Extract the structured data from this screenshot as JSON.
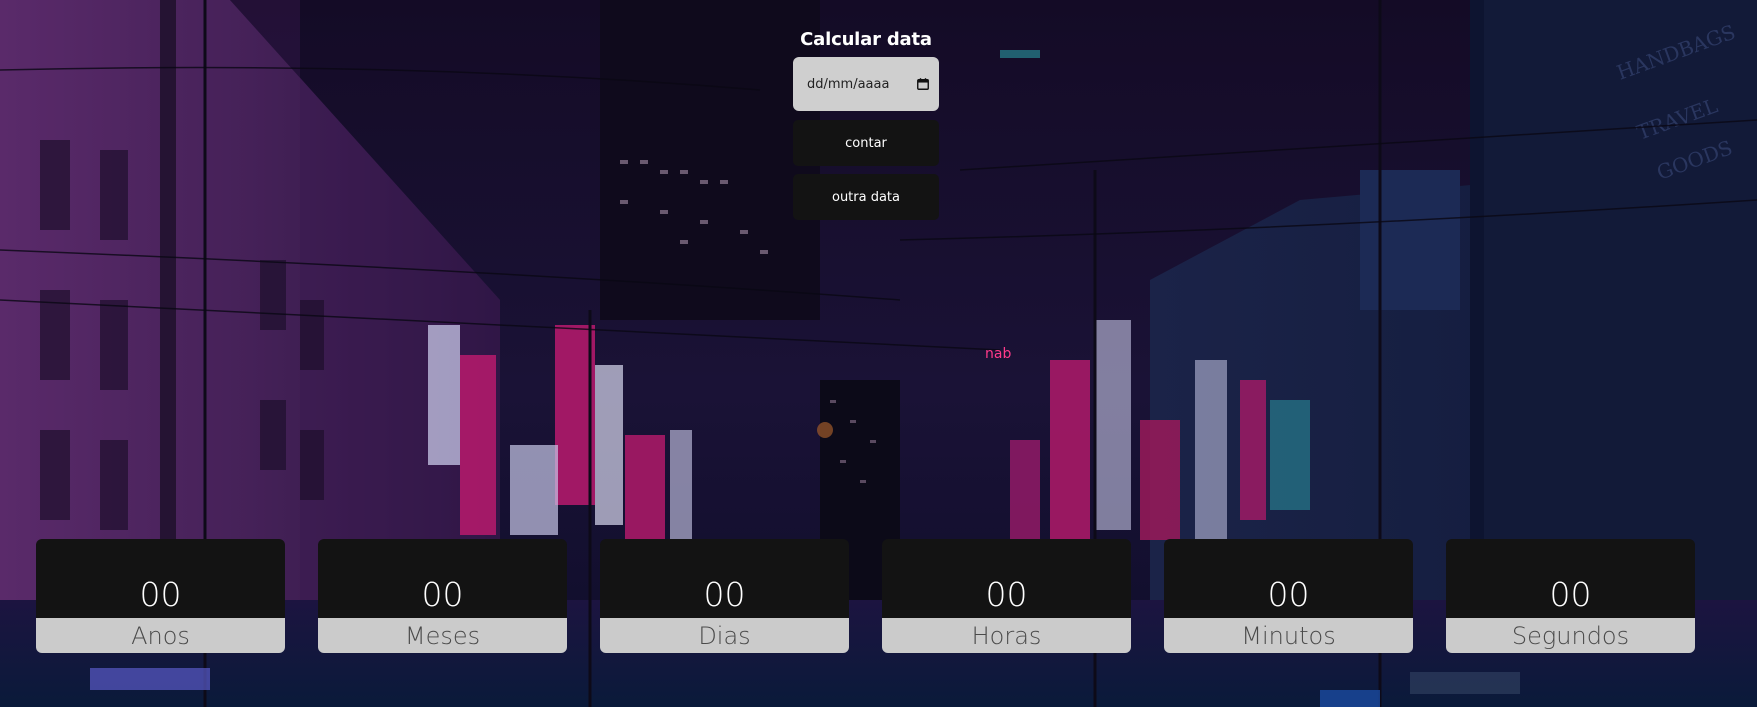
{
  "header": {
    "title": "Calcular data"
  },
  "date_input": {
    "placeholder": "dd/mm/aaaa",
    "icon": "calendar-icon"
  },
  "buttons": {
    "count_label": "contar",
    "other_date_label": "outra data"
  },
  "counters": [
    {
      "value": "00",
      "label": "Anos"
    },
    {
      "value": "00",
      "label": "Meses"
    },
    {
      "value": "00",
      "label": "Dias"
    },
    {
      "value": "00",
      "label": "Horas"
    },
    {
      "value": "00",
      "label": "Minutos"
    },
    {
      "value": "00",
      "label": "Segundos"
    }
  ],
  "colors": {
    "box_dark": "#131313",
    "box_light": "#cbcbcb",
    "input_bg": "#cfcfcf",
    "title_text": "#ffffff"
  }
}
